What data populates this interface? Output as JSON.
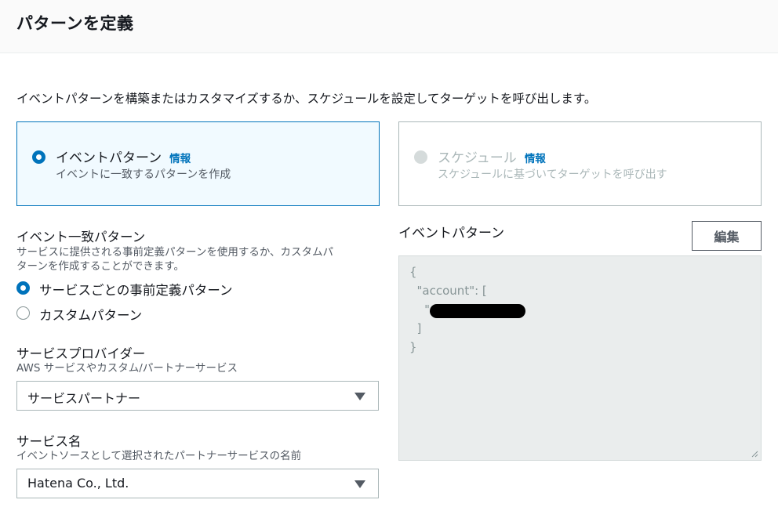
{
  "header": {
    "title": "パターンを定義"
  },
  "description": "イベントパターンを構築またはカスタマイズするか、スケジュールを設定してターゲットを呼び出します。",
  "tiles": [
    {
      "title": "イベントパターン",
      "info": "情報",
      "sub": "イベントに一致するパターンを作成",
      "selected": true
    },
    {
      "title": "スケジュール",
      "info": "情報",
      "sub": "スケジュールに基づいてターゲットを呼び出す",
      "selected": false
    }
  ],
  "match_section": {
    "label": "イベント一致パターン",
    "desc_line1": "サービスに提供される事前定義パターンを使用するか、カスタムパ",
    "desc_line2": "ターンを作成することができます。",
    "options": [
      {
        "label": "サービスごとの事前定義パターン",
        "checked": true
      },
      {
        "label": "カスタムパターン",
        "checked": false
      }
    ]
  },
  "provider": {
    "label": "サービスプロバイダー",
    "desc": "AWS サービスやカスタム/パートナーサービス",
    "value": "サービスパートナー"
  },
  "service_name": {
    "label": "サービス名",
    "desc": "イベントソースとして選択されたパートナーサービスの名前",
    "value": "Hatena Co., Ltd."
  },
  "event_pattern": {
    "label": "イベントパターン",
    "edit_label": "編集",
    "code": "{\n  \"account\": [\n    \"\n  ]\n}"
  },
  "colors": {
    "accent": "#0073bb",
    "code_bg": "#eaeded",
    "disabled": "#aab7b8"
  }
}
